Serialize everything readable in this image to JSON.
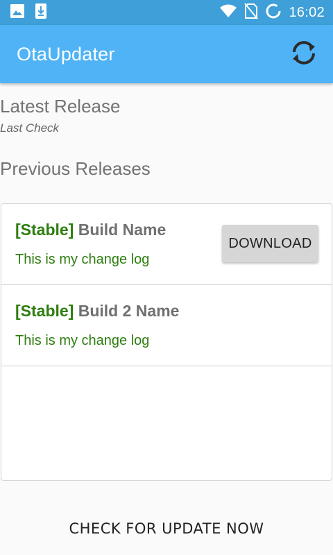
{
  "status_bar": {
    "time": "16:02",
    "icons": [
      "image-icon",
      "download-notification-icon",
      "wifi-icon",
      "no-sim-icon",
      "sync-loading-icon"
    ]
  },
  "app_bar": {
    "title": "OtaUpdater",
    "refresh_icon": "refresh-icon",
    "color": "#4fb3f6"
  },
  "latest": {
    "title": "Latest Release",
    "subtitle": "Last Check"
  },
  "previous": {
    "title": "Previous Releases",
    "releases": [
      {
        "tag": "[Stable]",
        "name": "Build Name",
        "changelog": "This is my change log",
        "button": "DOWNLOAD"
      },
      {
        "tag": "[Stable]",
        "name": "Build 2 Name",
        "changelog": "This is my change log"
      }
    ]
  },
  "check_button": "CHECK FOR UPDATE NOW",
  "colors": {
    "status_bar": "#3f9fd8",
    "stable_tag": "#2e7d0f"
  }
}
